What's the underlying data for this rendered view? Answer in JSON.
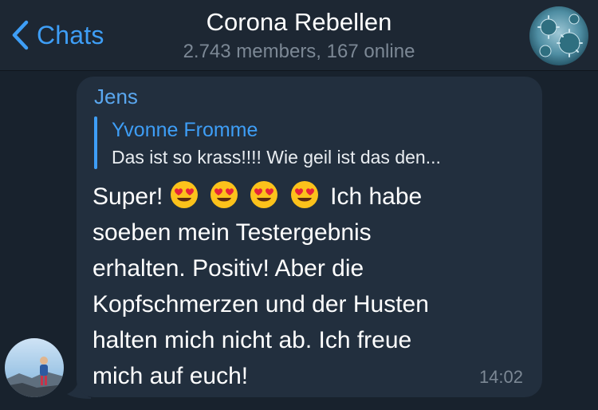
{
  "header": {
    "back_label": "Chats",
    "title": "Corona Rebellen",
    "subtitle": "2.743 members, 167 online"
  },
  "message": {
    "sender": "Jens",
    "reply": {
      "author": "Yvonne Fromme",
      "text": "Das ist so krass!!!! Wie geil ist das den..."
    },
    "text_start": "Super!",
    "emojis": [
      "heart-eyes-emoji",
      "heart-eyes-emoji",
      "heart-eyes-emoji",
      "heart-eyes-emoji"
    ],
    "text_line1_tail": "Ich habe",
    "lines": [
      "soeben mein Testergebnis",
      "erhalten. Positiv! Aber die",
      "Kopfschmerzen und der Husten",
      "halten mich nicht ab. Ich freue",
      "mich auf euch!"
    ],
    "time": "14:02"
  },
  "colors": {
    "background": "#18222d",
    "header": "#1d2733",
    "bubble": "#222f3e",
    "accent": "#3e9ef6"
  }
}
